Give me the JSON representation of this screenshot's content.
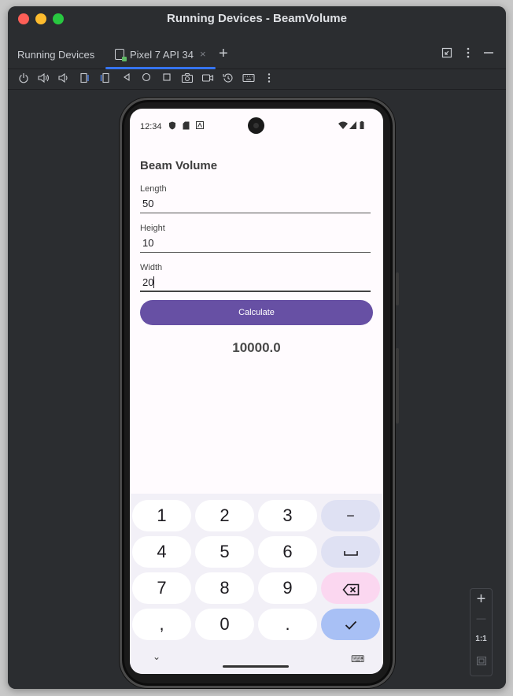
{
  "window": {
    "title": "Running Devices - BeamVolume"
  },
  "tabs": {
    "tool_title": "Running Devices",
    "device_tab": "Pixel 7 API 34",
    "close_glyph": "×",
    "add_glyph": "+"
  },
  "toolbar_icons": [
    "power-icon",
    "volume-up-icon",
    "volume-down-icon",
    "rotate-left-icon",
    "rotate-right-icon",
    "back-icon",
    "home-icon",
    "overview-icon",
    "screenshot-icon",
    "screen-record-icon",
    "snapshot-icon",
    "keyboard-icon",
    "more-icon"
  ],
  "device": {
    "status_bar": {
      "time": "12:34"
    },
    "app": {
      "title": "Beam Volume",
      "fields": [
        {
          "label": "Length",
          "value": "50"
        },
        {
          "label": "Height",
          "value": "10"
        },
        {
          "label": "Width",
          "value": "20"
        }
      ],
      "button_label": "Calculate",
      "result": "10000.0",
      "accent_color": "#6750a4"
    },
    "keyboard": {
      "rows": [
        [
          "1",
          "2",
          "3",
          "−"
        ],
        [
          "4",
          "5",
          "6",
          "␣"
        ],
        [
          "7",
          "8",
          "9",
          "⌫"
        ],
        [
          ",",
          "0",
          ".",
          "✓"
        ]
      ],
      "hide_glyph": "⌄",
      "switch_glyph": "⌨"
    }
  },
  "zoom": {
    "plus": "+",
    "minus": "—",
    "actual_size": "1:1"
  }
}
